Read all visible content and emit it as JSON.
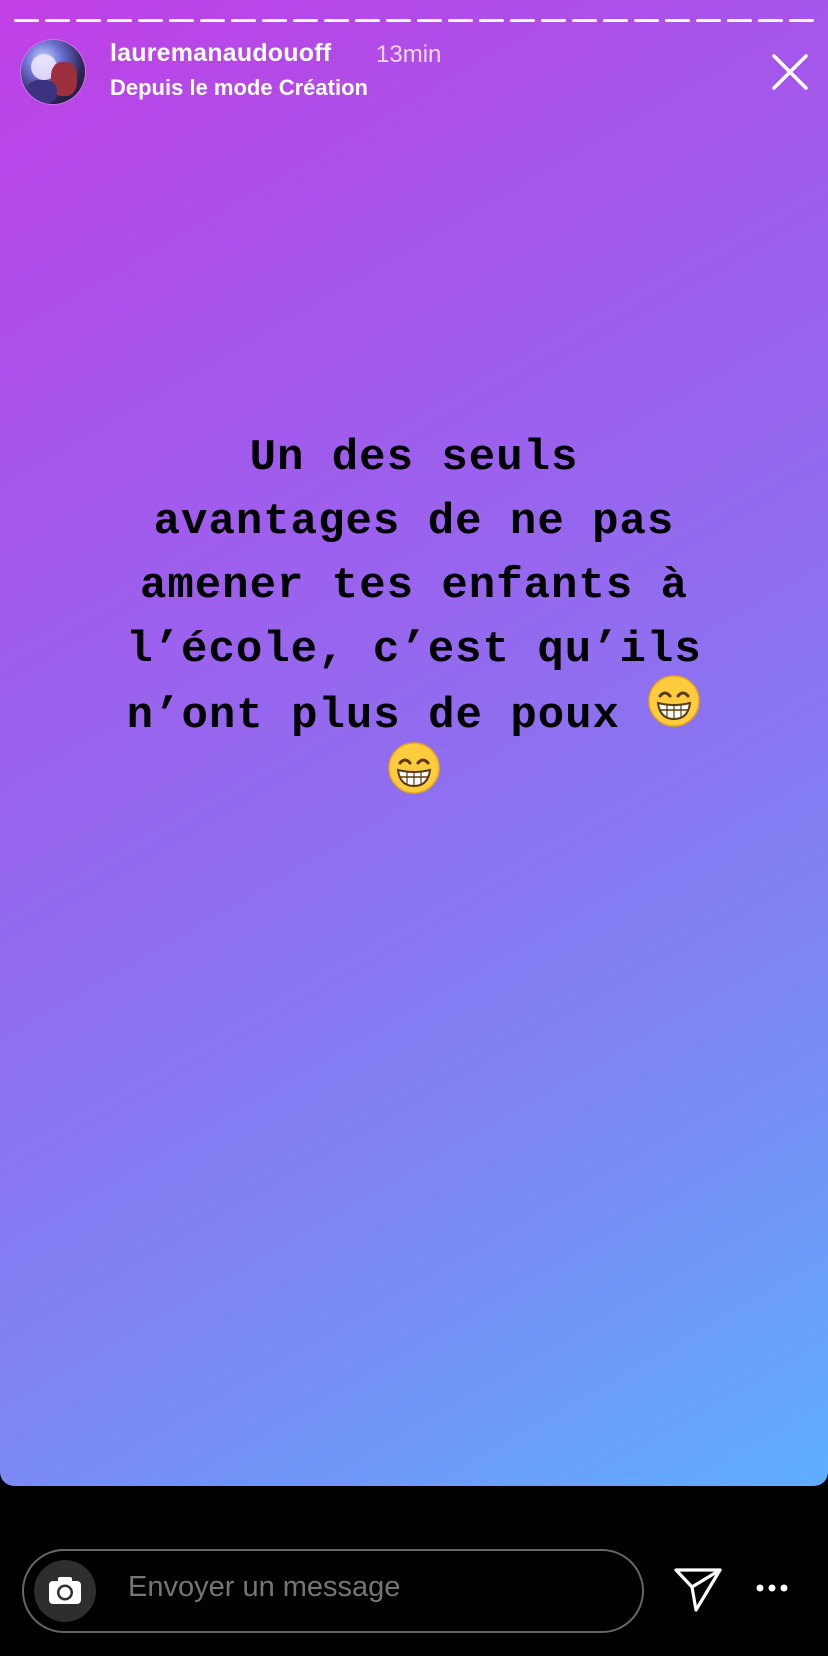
{
  "story": {
    "username": "lauremanaudouoff",
    "time_ago": "13min",
    "subtitle": "Depuis le mode Création",
    "progress_segments": 26,
    "progress_current": 26,
    "caption_lines": [
      "Un des seuls",
      "avantages de ne pas",
      "amener tes enfants à",
      "l’école, c’est qu’ils",
      "n’ont plus de poux"
    ],
    "caption_emoji": "grinning-face-with-smiling-eyes"
  },
  "footer": {
    "message_placeholder": "Envoyer un message"
  },
  "icons": {
    "close": "close-icon",
    "camera": "camera-icon",
    "send": "send-icon",
    "more": "more-icon"
  }
}
